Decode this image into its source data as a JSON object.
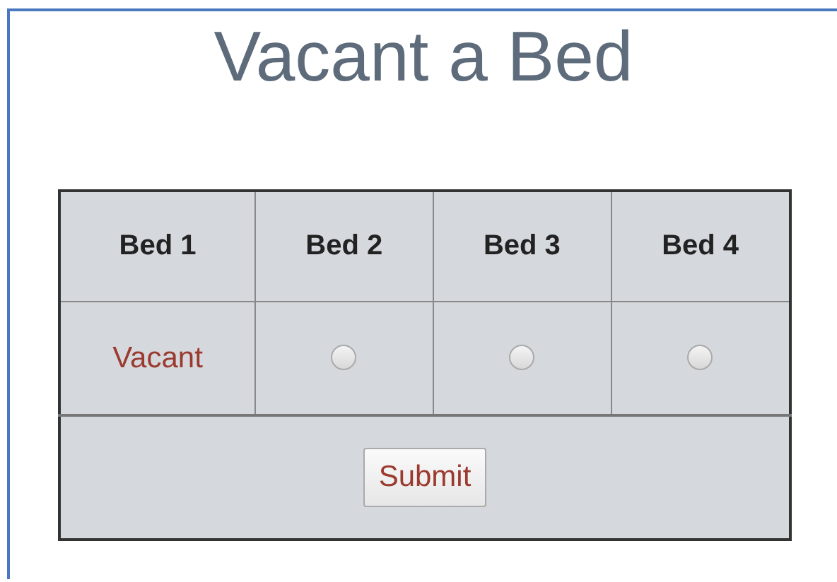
{
  "title": "Vacant a Bed",
  "columns": [
    "Bed 1",
    "Bed 2",
    "Bed 3",
    "Bed 4"
  ],
  "cells": [
    {
      "kind": "status",
      "text": "Vacant"
    },
    {
      "kind": "radio",
      "selected": false
    },
    {
      "kind": "radio",
      "selected": false
    },
    {
      "kind": "radio",
      "selected": false
    }
  ],
  "submit_button": "Submit"
}
